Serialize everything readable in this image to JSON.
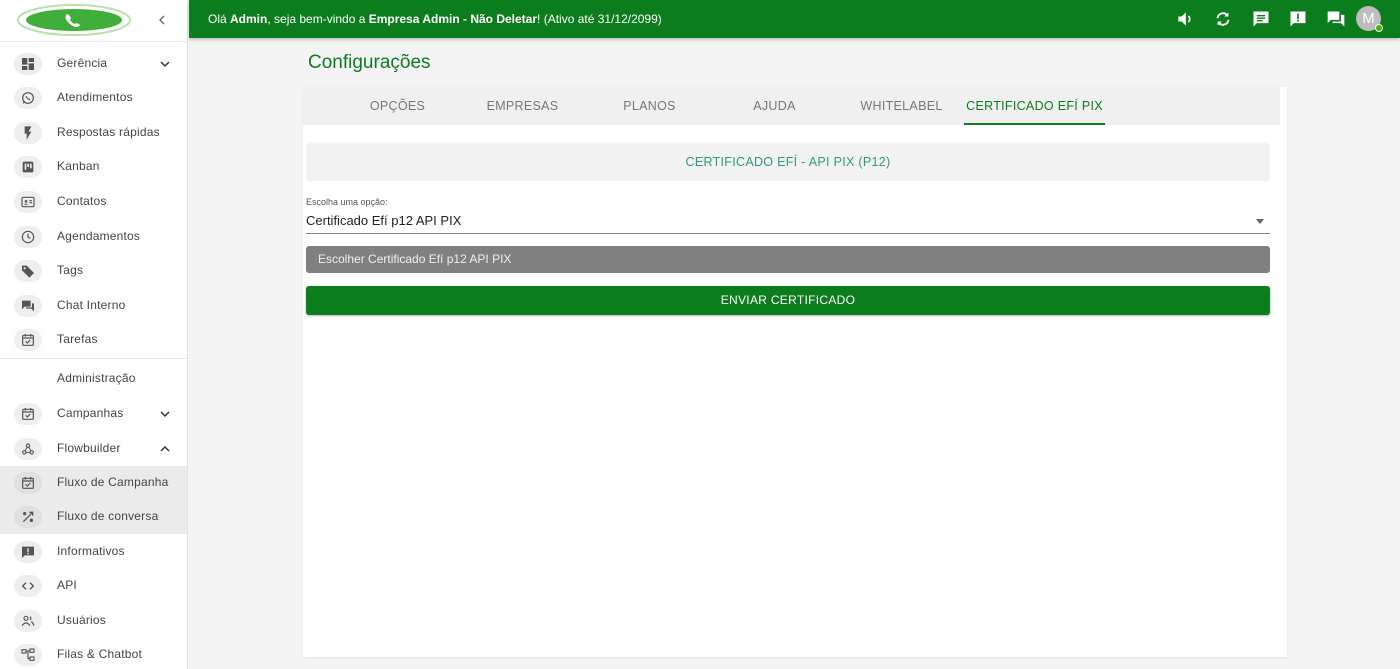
{
  "colors": {
    "brand": "#0b7d1d",
    "accent_text": "#2e9e6b",
    "file_button": "#808080"
  },
  "sidebar": {
    "logo_icon": "whatsapp-logo",
    "collapse_icon": "chevron-left-icon",
    "items": [
      {
        "label": "Gerência",
        "icon": "dashboard-icon",
        "chevron": "chevron-down"
      },
      {
        "label": "Atendimentos",
        "icon": "whatsapp-icon"
      },
      {
        "label": "Respostas rápidas",
        "icon": "flash-icon"
      },
      {
        "label": "Kanban",
        "icon": "kanban-icon"
      },
      {
        "label": "Contatos",
        "icon": "contacts-icon"
      },
      {
        "label": "Agendamentos",
        "icon": "clock-icon"
      },
      {
        "label": "Tags",
        "icon": "tag-icon"
      },
      {
        "label": "Chat Interno",
        "icon": "forum-icon"
      },
      {
        "label": "Tarefas",
        "icon": "event-check-icon"
      }
    ],
    "section_label": "Administração",
    "admin_items": [
      {
        "label": "Campanhas",
        "icon": "event-check-icon",
        "chevron": "chevron-down"
      },
      {
        "label": "Flowbuilder",
        "icon": "webhook-icon",
        "chevron": "chevron-up"
      },
      {
        "label": "Fluxo de Campanha",
        "icon": "event-check-icon",
        "sub": true
      },
      {
        "label": "Fluxo de conversa",
        "icon": "shuffle-icon",
        "sub": true
      },
      {
        "label": "Informativos",
        "icon": "announcement-icon"
      },
      {
        "label": "API",
        "icon": "code-icon"
      },
      {
        "label": "Usuários",
        "icon": "people-icon"
      },
      {
        "label": "Filas & Chatbot",
        "icon": "account-tree-icon"
      }
    ]
  },
  "topbar": {
    "greeting_prefix": "Olá ",
    "user": "Admin",
    "greeting_mid": ", seja bem-vindo a ",
    "company": "Empresa Admin - Não Deletar",
    "greeting_suffix": "! (Ativo até 31/12/2099)",
    "icons": [
      "volume-icon",
      "sync-icon",
      "chat-icon",
      "announcement-icon",
      "forum-icon"
    ],
    "avatar_letter": "M"
  },
  "page": {
    "title": "Configurações",
    "tabs": [
      "OPÇÕES",
      "EMPRESAS",
      "PLANOS",
      "AJUDA",
      "WHITELABEL",
      "CERTIFICADO EFÍ PIX"
    ],
    "active_tab": "CERTIFICADO EFÍ PIX"
  },
  "certificate": {
    "header": "CERTIFICADO EFÍ - API PIX (P12)",
    "select_label": "Escolha uma opção:",
    "select_value": "Certificado Efí p12 API PIX",
    "file_button": "Escolher Certificado Efí p12 API PIX",
    "send_button": "ENVIAR CERTIFICADO"
  }
}
